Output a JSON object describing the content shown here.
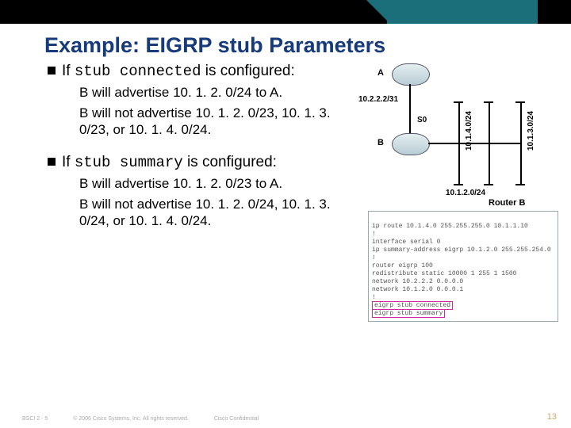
{
  "header": {
    "title": "Example: EIGRP stub Parameters"
  },
  "sections": [
    {
      "prefix": "If ",
      "code": "stub connected",
      "suffix": " is configured:",
      "subs": [
        "B will advertise 10. 1. 2. 0/24 to A.",
        "B will not advertise 10. 1. 2. 0/23, 10. 1. 3. 0/23, or 10. 1. 4. 0/24."
      ]
    },
    {
      "prefix": "If ",
      "code": "stub summary",
      "suffix": " is configured:",
      "subs": [
        "B will advertise 10. 1. 2. 0/23 to A.",
        "B will not advertise 10. 1. 2. 0/24, 10. 1. 3. 0/24, or 10. 1. 4. 0/24."
      ]
    }
  ],
  "diagram": {
    "routerA": "A",
    "routerB": "B",
    "net_ab": "10.2.2.2/31",
    "net_b_left": "10.1.4.0/24",
    "net_b_mid": "10.1.2.0/24",
    "net_b_right": "10.1.3.0/24",
    "if_s0": "S0",
    "routerB_title": "Router B",
    "config": [
      "ip route 10.1.4.0 255.255.255.0 10.1.1.10",
      "!",
      "interface serial 0",
      "ip summary-address eigrp 10.1.2.0 255.255.254.0",
      "!",
      "router eigrp 100",
      "redistribute static 10000 1 255 1 1500",
      "network 10.2.2.2 0.0.0.0",
      "network 10.1.2.0 0.0.0.1",
      "!",
      "eigrp stub connected",
      "eigrp stub summary"
    ]
  },
  "footer": {
    "left": "BSCI 2 - 5",
    "mid": "© 2006 Cisco Systems, Inc. All rights reserved.",
    "right": "Cisco Confidential",
    "page": "13"
  }
}
